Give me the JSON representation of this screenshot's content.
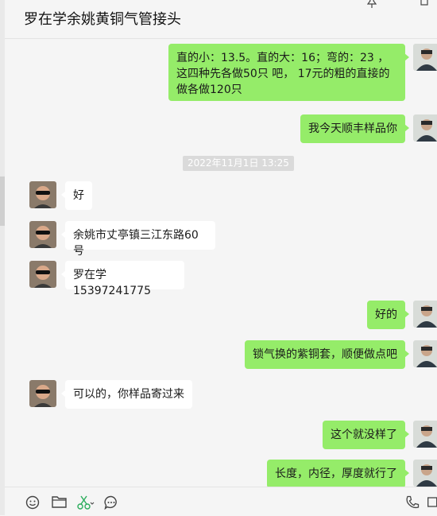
{
  "window": {
    "title": "罗在学余姚黄铜气管接头"
  },
  "header_icons": [
    "pin-icon",
    "more-icon"
  ],
  "timestamp": "2022年11月1日 13:25",
  "messages": [
    {
      "side": "me",
      "text": "直的小：13.5。直的大：16；弯的：23 ，这四种先各做50只 吧， 17元的粗的直接的做各做120只"
    },
    {
      "side": "me",
      "text": "我今天顺丰样品你"
    },
    {
      "side": "them",
      "text": "好"
    },
    {
      "side": "them",
      "text": "余姚市丈亭镇三江东路60号"
    },
    {
      "side": "them",
      "text": "罗在学15397241775"
    },
    {
      "side": "me",
      "text": "好的"
    },
    {
      "side": "me",
      "text": "锁气换的紫铜套，顺便做点吧"
    },
    {
      "side": "them",
      "text": "可以的，你样品寄过来"
    },
    {
      "side": "me",
      "text": "这个就没样了"
    },
    {
      "side": "me",
      "text": "长度，内径，厚度就行了"
    }
  ],
  "toolbar_icons": [
    "emoji-icon",
    "folder-icon",
    "scissors-icon",
    "chat-history-icon",
    "phone-icon",
    "video-icon"
  ],
  "colors": {
    "my_bubble": "#95ec69",
    "their_bubble": "#ffffff",
    "background": "#f5f5f5"
  }
}
